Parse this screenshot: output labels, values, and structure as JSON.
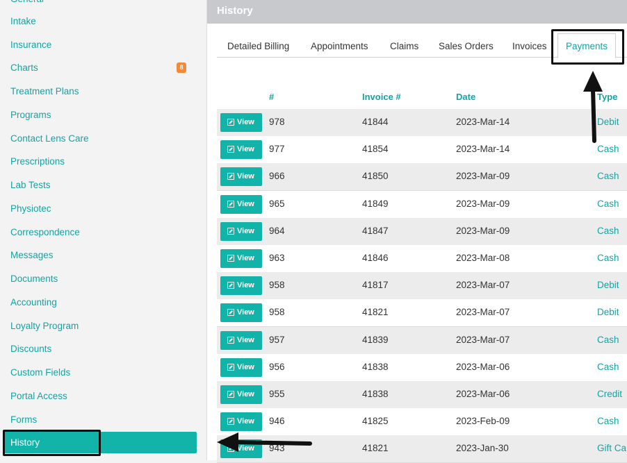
{
  "sidebar": {
    "items": [
      {
        "label": "General"
      },
      {
        "label": "Intake"
      },
      {
        "label": "Insurance"
      },
      {
        "label": "Charts",
        "badge": "8"
      },
      {
        "label": "Treatment Plans"
      },
      {
        "label": "Programs"
      },
      {
        "label": "Contact Lens Care"
      },
      {
        "label": "Prescriptions"
      },
      {
        "label": "Lab Tests"
      },
      {
        "label": "Physiotec"
      },
      {
        "label": "Correspondence"
      },
      {
        "label": "Messages"
      },
      {
        "label": "Documents"
      },
      {
        "label": "Accounting"
      },
      {
        "label": "Loyalty Program"
      },
      {
        "label": "Discounts"
      },
      {
        "label": "Custom Fields"
      },
      {
        "label": "Portal Access"
      },
      {
        "label": "Forms"
      },
      {
        "label": "History",
        "active": true
      }
    ]
  },
  "header": {
    "title": "History"
  },
  "tabs": [
    {
      "label": "Detailed Billing"
    },
    {
      "label": "Appointments"
    },
    {
      "label": "Claims"
    },
    {
      "label": "Sales Orders"
    },
    {
      "label": "Invoices"
    },
    {
      "label": "Payments",
      "active": true
    }
  ],
  "table": {
    "columns": [
      "#",
      "Invoice #",
      "Date",
      "Type"
    ],
    "view_label": "View",
    "rows": [
      {
        "num": "978",
        "invoice": "41844",
        "date": "2023-Mar-14",
        "type": "Debit"
      },
      {
        "num": "977",
        "invoice": "41854",
        "date": "2023-Mar-14",
        "type": "Cash"
      },
      {
        "num": "966",
        "invoice": "41850",
        "date": "2023-Mar-09",
        "type": "Cash"
      },
      {
        "num": "965",
        "invoice": "41849",
        "date": "2023-Mar-09",
        "type": "Cash"
      },
      {
        "num": "964",
        "invoice": "41847",
        "date": "2023-Mar-09",
        "type": "Cash"
      },
      {
        "num": "963",
        "invoice": "41846",
        "date": "2023-Mar-08",
        "type": "Cash"
      },
      {
        "num": "958",
        "invoice": "41817",
        "date": "2023-Mar-07",
        "type": "Debit"
      },
      {
        "num": "958",
        "invoice": "41821",
        "date": "2023-Mar-07",
        "type": "Debit"
      },
      {
        "num": "957",
        "invoice": "41839",
        "date": "2023-Mar-07",
        "type": "Cash"
      },
      {
        "num": "956",
        "invoice": "41838",
        "date": "2023-Mar-06",
        "type": "Cash"
      },
      {
        "num": "955",
        "invoice": "41838",
        "date": "2023-Mar-06",
        "type": "Credit"
      },
      {
        "num": "946",
        "invoice": "41825",
        "date": "2023-Feb-09",
        "type": "Cash"
      },
      {
        "num": "943",
        "invoice": "41821",
        "date": "2023-Jan-30",
        "type": "Gift Card"
      }
    ]
  },
  "colors": {
    "accent": "#12b3a8",
    "link": "#14a3a3",
    "badge": "#f28a3c",
    "header": "#c8c9cc"
  }
}
